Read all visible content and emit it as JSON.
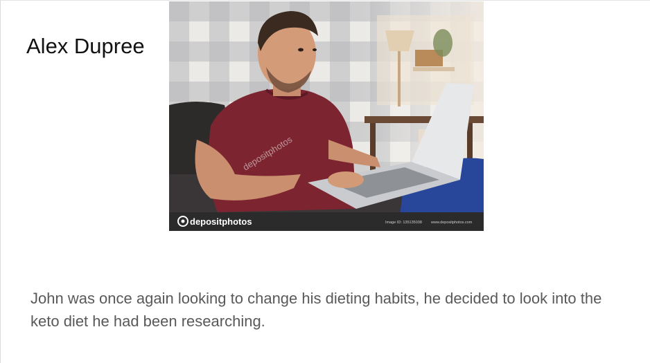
{
  "slide": {
    "author": "Alex Dupree",
    "caption": "John was once again looking to change his dieting habits, he decided to look into the keto diet he had been researching."
  },
  "photo": {
    "subject": "man in maroon t-shirt smiling while typing on a laptop on a sofa",
    "watermark_brand": "depositphotos",
    "watermark_overlay": "depositphotos",
    "footer_image_id": "Image ID: 135135038",
    "footer_site": "www.depositphotos.com"
  },
  "colors": {
    "author_text": "#111111",
    "caption_text": "#595959",
    "watermark_bar": "#2b2b2b"
  }
}
